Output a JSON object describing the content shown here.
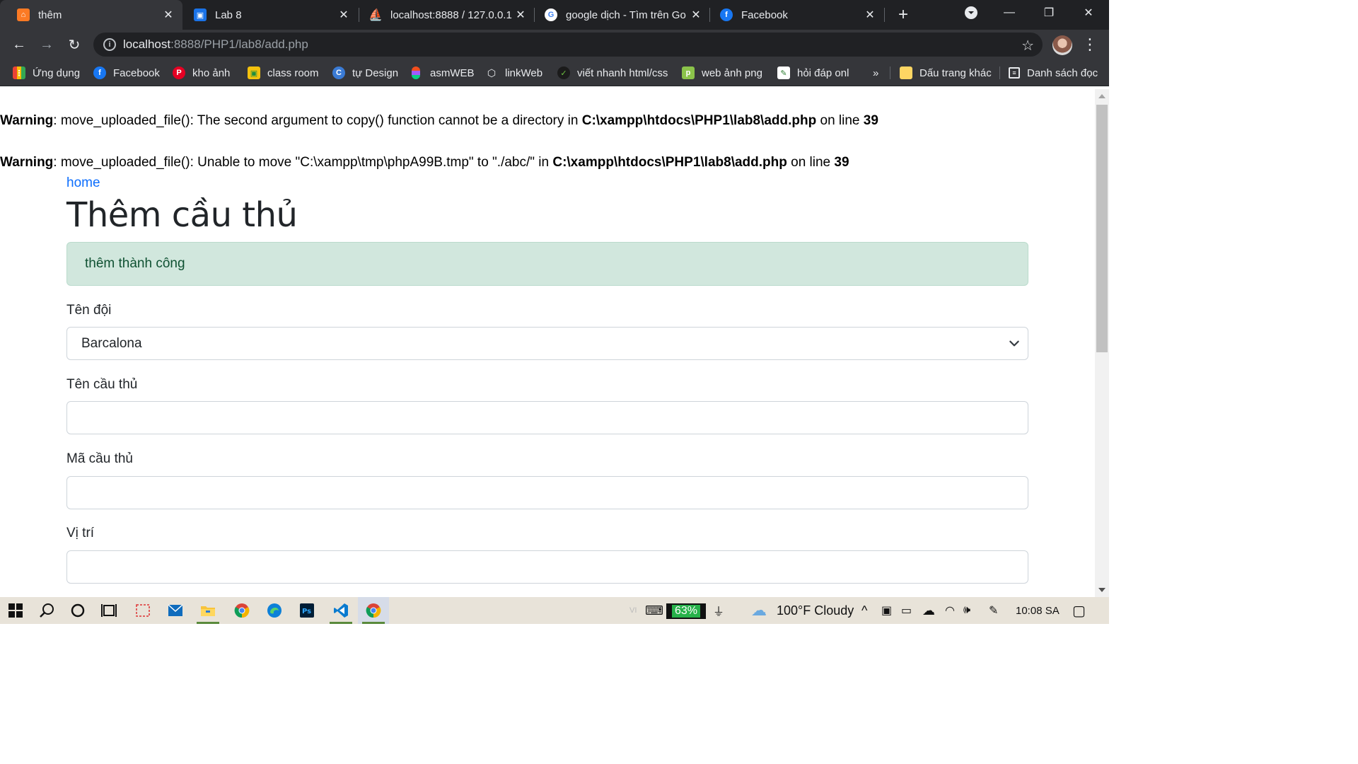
{
  "browser": {
    "tabs": [
      {
        "title": "thêm",
        "active": true,
        "icon": "xampp-icon",
        "color": "#fb7a24"
      },
      {
        "title": "Lab 8",
        "active": false,
        "icon": "google-classroom-icon",
        "color": "#1a73e8"
      },
      {
        "title": "localhost:8888 / 127.0.0.1",
        "active": false,
        "icon": "phpmyadmin-icon",
        "color": "#f89c0e"
      },
      {
        "title": "google dịch - Tìm trên Go",
        "active": false,
        "icon": "google-icon",
        "color": "#4285f4"
      },
      {
        "title": "Facebook",
        "active": false,
        "icon": "facebook-icon",
        "color": "#1877f2"
      }
    ],
    "new_tab": "+",
    "window_controls": {
      "minimize": "—",
      "restore": "❐",
      "close": "✕"
    },
    "address": {
      "host": "localhost",
      "path": ":8888/PHP1/lab8/add.php"
    },
    "nav": {
      "back": "←",
      "forward": "→",
      "reload": "↻"
    },
    "bookmarks": [
      {
        "label": "Ứng dụng",
        "icon": "apps-grid-icon"
      },
      {
        "label": "Facebook",
        "icon": "facebook-icon"
      },
      {
        "label": "kho ảnh",
        "icon": "pinterest-icon"
      },
      {
        "label": "class room",
        "icon": "classroom-icon"
      },
      {
        "label": "tự Design",
        "icon": "canva-icon"
      },
      {
        "label": "asmWEB",
        "icon": "figma-icon"
      },
      {
        "label": "linkWeb",
        "icon": "codepen-icon"
      },
      {
        "label": "viết nhanh html/css",
        "icon": "emmet-icon"
      },
      {
        "label": "web ảnh png",
        "icon": "pngtree-icon"
      },
      {
        "label": "hỏi đáp onl",
        "icon": "quizizz-icon"
      }
    ],
    "bookmarks_overflow": "»",
    "other_bookmarks": "Dấu trang khác",
    "reading_list": "Danh sách đọc"
  },
  "page": {
    "warnings": [
      {
        "prefix": "Warning",
        "message": ": move_uploaded_file(): The second argument to copy() function cannot be a directory in ",
        "file": "C:\\xampp\\htdocs\\PHP1\\lab8\\add.php",
        "on_line": " on line ",
        "line": "39"
      },
      {
        "prefix": "Warning",
        "message": ": move_uploaded_file(): Unable to move \"C:\\xampp\\tmp\\phpA99B.tmp\" to \"./abc/\" in ",
        "file": "C:\\xampp\\htdocs\\PHP1\\lab8\\add.php",
        "on_line": " on line ",
        "line": "39"
      }
    ],
    "home_link": "home",
    "heading": "Thêm cầu thủ",
    "alert": "thêm thành công",
    "form": {
      "team_label": "Tên đội",
      "team_value": "Barcalona",
      "player_name_label": "Tên cầu thủ",
      "player_name_value": "",
      "player_code_label": "Mã cầu thủ",
      "player_code_value": "",
      "position_label": "Vị trí",
      "position_value": ""
    }
  },
  "taskbar": {
    "apps": [
      "windows-start-icon",
      "search-icon",
      "cortana-icon",
      "task-view-icon",
      "snipping-icon",
      "mail-icon",
      "file-explorer-icon",
      "chrome-icon",
      "edge-icon",
      "photoshop-icon",
      "vscode-icon",
      "chrome-canary-icon"
    ],
    "battery_percent": "63%",
    "weather": "100°F  Cloudy",
    "time": "10:08 SA",
    "input_indicator": "VI"
  }
}
